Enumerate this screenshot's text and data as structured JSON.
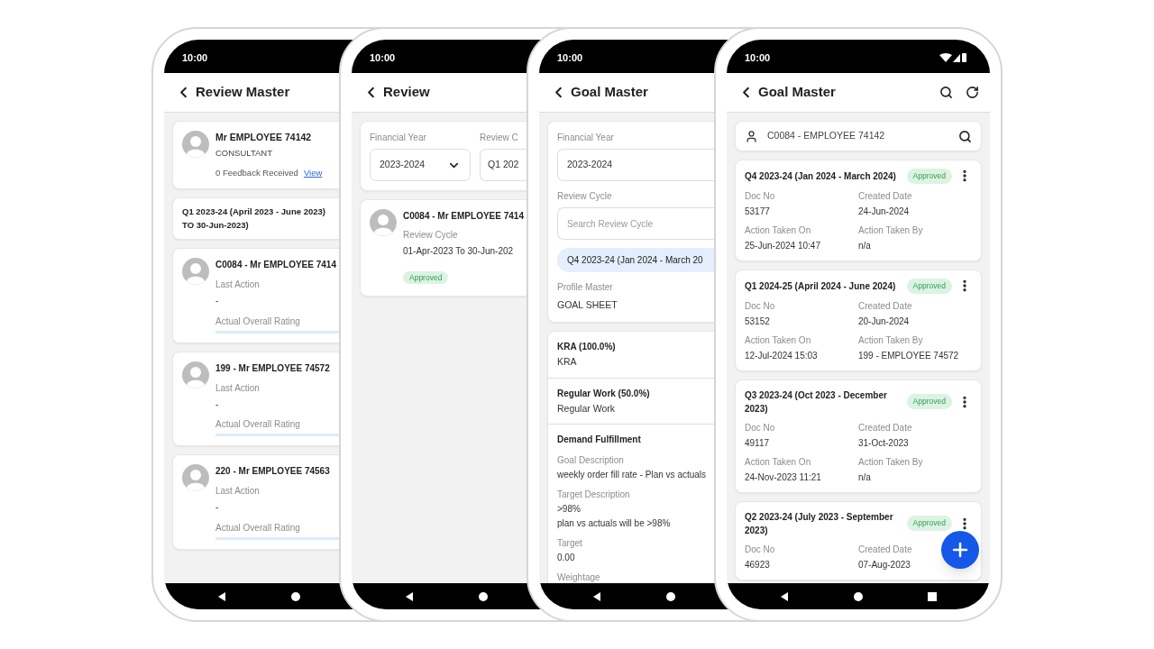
{
  "phones": [
    {
      "kind": "review_master",
      "time": "10:00",
      "title": "Review Master",
      "profile": {
        "name": "Mr EMPLOYEE 74142",
        "designation": "CONSULTANT",
        "feedback": "0 Feedback Received",
        "link": "View"
      },
      "period_lines": [
        "Q1 2023-24 (April 2023 - June 2023)",
        "TO 30-Jun-2023)"
      ],
      "employees": [
        {
          "name": "C0084 - Mr EMPLOYEE 7414",
          "last_action_label": "Last Action",
          "last_action": "-",
          "rating_label": "Actual Overall Rating"
        },
        {
          "name": "199 - Mr EMPLOYEE 74572",
          "last_action_label": "Last Action",
          "last_action": "-",
          "rating_label": "Actual Overall Rating"
        },
        {
          "name": "220 - Mr EMPLOYEE 74563",
          "last_action_label": "Last Action",
          "last_action": "-",
          "rating_label": "Actual Overall Rating"
        }
      ]
    },
    {
      "kind": "review",
      "time": "10:00",
      "title": "Review",
      "filters": [
        {
          "label": "Financial Year",
          "value": "2023-2024",
          "dropdown": true
        },
        {
          "label": "Review C",
          "value": "Q1 202",
          "dropdown": false
        }
      ],
      "reviews": [
        {
          "name": "C0084 - Mr EMPLOYEE 7414",
          "cycle_label": "Review Cycle",
          "cycle": "01-Apr-2023 To 30-Jun-202",
          "status": "Approved"
        }
      ]
    },
    {
      "kind": "goal_detail",
      "time": "10:00",
      "title": "Goal Master",
      "financial_year": {
        "label": "Financial Year",
        "value": "2023-2024"
      },
      "review_cycle": {
        "label": "Review Cycle",
        "placeholder": "Search Review Cycle"
      },
      "cycle_chips": [
        {
          "label": "Q4 2023-24 (Jan 2024 - March 20",
          "selected": true
        }
      ],
      "profile": {
        "label": "Profile Master",
        "value": "GOAL SHEET"
      },
      "sections": [
        {
          "title": "KRA (100.0%)",
          "subtitle": "KRA"
        },
        {
          "title": "Regular Work (50.0%)",
          "subtitle": "Regular Work"
        }
      ],
      "goal": {
        "title": "Demand Fulfillment",
        "fields": [
          {
            "label": "Goal Description",
            "lines": [
              "weekly order fill rate - Plan vs actuals"
            ]
          },
          {
            "label": "Target Description",
            "lines": [
              ">98%",
              "plan vs actuals will be >98%"
            ]
          },
          {
            "label": "Target",
            "lines": [
              "0.00"
            ]
          },
          {
            "label": "Weightage"
          }
        ]
      }
    },
    {
      "kind": "goal_list",
      "time": "10:00",
      "title": "Goal Master",
      "employee_search": {
        "value": "C0084 - EMPLOYEE 74142"
      },
      "goals": [
        {
          "period": "Q4 2023-24 (Jan 2024 - March 2024)",
          "status": "Approved",
          "fields": [
            {
              "label": "Doc No",
              "value": "53177"
            },
            {
              "label": "Created Date",
              "value": "24-Jun-2024"
            },
            {
              "label": "Action Taken On",
              "value": "25-Jun-2024 10:47"
            },
            {
              "label": "Action Taken By",
              "value": "n/a"
            }
          ]
        },
        {
          "period": "Q1 2024-25 (April 2024 - June 2024)",
          "status": "Approved",
          "fields": [
            {
              "label": "Doc No",
              "value": "53152"
            },
            {
              "label": "Created Date",
              "value": "20-Jun-2024"
            },
            {
              "label": "Action Taken On",
              "value": "12-Jul-2024 15:03"
            },
            {
              "label": "Action Taken By",
              "value": "199 - EMPLOYEE 74572"
            }
          ]
        },
        {
          "period": "Q3 2023-24 (Oct 2023 - December 2023)",
          "status": "Approved",
          "fields": [
            {
              "label": "Doc No",
              "value": "49117"
            },
            {
              "label": "Created Date",
              "value": "31-Oct-2023"
            },
            {
              "label": "Action Taken On",
              "value": "24-Nov-2023 11:21"
            },
            {
              "label": "Action Taken By",
              "value": "n/a"
            }
          ]
        },
        {
          "period": "Q2 2023-24 (July 2023 - September 2023)",
          "status": "Approved",
          "fields": [
            {
              "label": "Doc No",
              "value": "46923"
            },
            {
              "label": "Created Date",
              "value": "07-Aug-2023"
            }
          ]
        }
      ]
    }
  ]
}
